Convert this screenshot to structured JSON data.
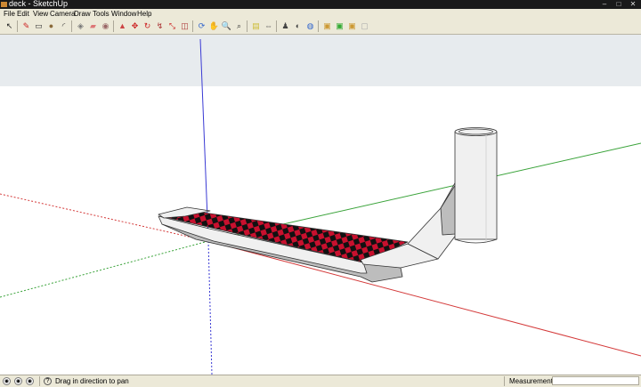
{
  "window": {
    "title": "deck - SketchUp"
  },
  "menu": [
    "File",
    "Edit",
    "View",
    "Camera",
    "Draw",
    "Tools",
    "Window",
    "Help"
  ],
  "toolbar": {
    "tools": [
      {
        "name": "select-tool-icon",
        "glyph": "↖",
        "color": "#222"
      },
      {
        "name": "pencil-line-icon",
        "glyph": "✎",
        "color": "#c22"
      },
      {
        "name": "rectangle-icon",
        "glyph": "▭",
        "color": "#333"
      },
      {
        "name": "circle-icon",
        "glyph": "●",
        "color": "#8a6a3a"
      },
      {
        "name": "arc-icon",
        "glyph": "◜",
        "color": "#333"
      },
      {
        "name": "make-component-icon",
        "glyph": "◈",
        "color": "#777"
      },
      {
        "name": "eraser-icon",
        "glyph": "▰",
        "color": "#d77"
      },
      {
        "name": "paint-bucket-icon",
        "glyph": "◉",
        "color": "#966"
      },
      {
        "name": "push-pull-icon",
        "glyph": "▲",
        "color": "#c44"
      },
      {
        "name": "move-icon",
        "glyph": "✥",
        "color": "#c22"
      },
      {
        "name": "rotate-icon",
        "glyph": "↻",
        "color": "#c22"
      },
      {
        "name": "follow-me-icon",
        "glyph": "↯",
        "color": "#a33"
      },
      {
        "name": "scale-icon",
        "glyph": "⤡",
        "color": "#c22"
      },
      {
        "name": "offset-icon",
        "glyph": "◫",
        "color": "#a33"
      },
      {
        "name": "orbit-icon",
        "glyph": "⟳",
        "color": "#36c"
      },
      {
        "name": "pan-icon",
        "glyph": "✋",
        "color": "#666"
      },
      {
        "name": "zoom-icon",
        "glyph": "🔍",
        "color": "#333"
      },
      {
        "name": "zoom-extents-icon",
        "glyph": "⌕",
        "color": "#333"
      },
      {
        "name": "tape-measure-icon",
        "glyph": "▤",
        "color": "#cb3"
      },
      {
        "name": "dimension-icon",
        "glyph": "⇔",
        "color": "#555"
      },
      {
        "name": "position-camera-icon",
        "glyph": "♟",
        "color": "#444"
      },
      {
        "name": "look-around-icon",
        "glyph": "◐",
        "color": "#444"
      },
      {
        "name": "walk-icon",
        "glyph": "◍",
        "color": "#36c"
      },
      {
        "name": "get-models-icon",
        "glyph": "▣",
        "color": "#c93"
      },
      {
        "name": "share-model-icon",
        "glyph": "▣",
        "color": "#3a3"
      },
      {
        "name": "share-component-icon",
        "glyph": "▣",
        "color": "#c93"
      },
      {
        "name": "place-component-icon",
        "glyph": "▢",
        "color": "#aaa"
      }
    ]
  },
  "viewport": {
    "axis_colors": {
      "red": "#d43a3a",
      "green": "#3aa33a",
      "blue": "#3a3ad4"
    },
    "deck_colors": {
      "checker_a": "#c8102e",
      "checker_b": "#111111",
      "body": "#f0f0f0",
      "shadow": "#bdbdbd"
    }
  },
  "status": {
    "hint": "Drag in direction to pan",
    "help_glyph": "?",
    "measurements_label": "Measurements",
    "measurements_value": ""
  }
}
